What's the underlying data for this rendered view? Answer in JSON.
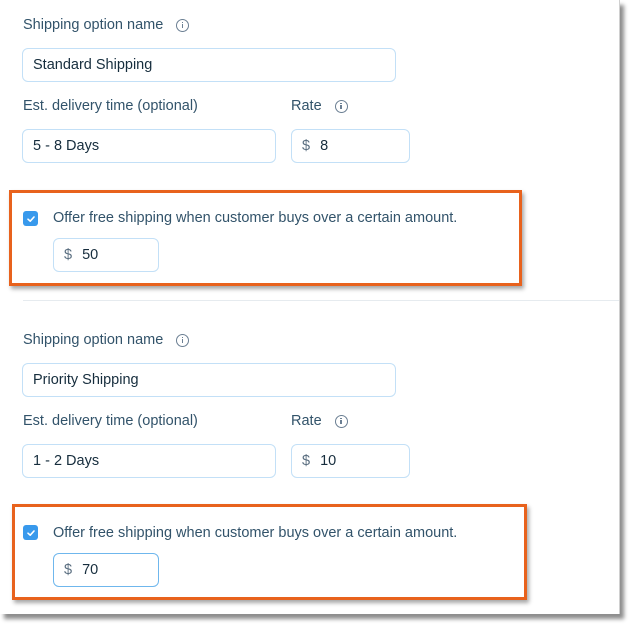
{
  "shipping_options": [
    {
      "name_label": "Shipping option name",
      "name_value": "Standard Shipping",
      "delivery_label": "Est. delivery time (optional)",
      "delivery_value": "5 - 8 Days",
      "rate_label": "Rate",
      "currency": "$",
      "rate_value": "8",
      "free_shipping_checked": true,
      "free_shipping_label": "Offer free shipping when customer buys over a certain amount.",
      "free_shipping_amount": "50"
    },
    {
      "name_label": "Shipping option name",
      "name_value": "Priority Shipping",
      "delivery_label": "Est. delivery time (optional)",
      "delivery_value": "1 - 2 Days",
      "rate_label": "Rate",
      "currency": "$",
      "rate_value": "10",
      "free_shipping_checked": true,
      "free_shipping_label": "Offer free shipping when customer buys over a certain amount.",
      "free_shipping_amount": "70"
    }
  ],
  "colors": {
    "highlight": "#e8621d",
    "checkbox": "#3899ec",
    "input_border": "#c3e0f7",
    "label_text": "#32536a"
  }
}
